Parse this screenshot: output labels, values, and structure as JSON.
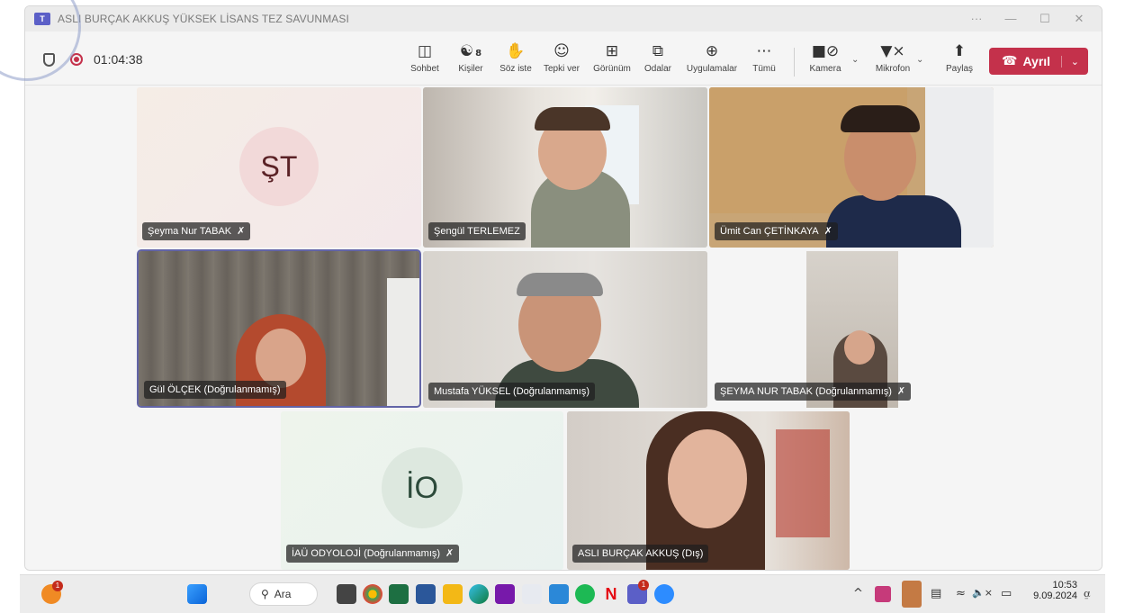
{
  "window": {
    "title": "ASLI BURÇAK AKKUŞ YÜKSEK LİSANS TEZ SAVUNMASI",
    "more": "···",
    "minimize": "—",
    "maximize": "☐",
    "close": "✕"
  },
  "meeting": {
    "timer": "01:04:38"
  },
  "toolbar": {
    "items": [
      {
        "label": "Sohbet",
        "glyph": "💬"
      },
      {
        "label": "Kişiler",
        "glyph": "👥",
        "count": "8"
      },
      {
        "label": "Söz iste",
        "glyph": "✋"
      },
      {
        "label": "Tepki ver",
        "glyph": "☺"
      },
      {
        "label": "Görünüm",
        "glyph": "⊞"
      },
      {
        "label": "Odalar",
        "glyph": "⧉"
      },
      {
        "label": "Uygulamalar",
        "glyph": "⊕"
      },
      {
        "label": "Tümü",
        "glyph": "···"
      },
      {
        "label": "Kamera",
        "glyph": "🎥"
      },
      {
        "label": "Mikrofon",
        "glyph": "🔇"
      },
      {
        "label": "Paylaş",
        "glyph": "⬆"
      }
    ],
    "leave_label": "Ayrıl"
  },
  "participants": [
    {
      "name": "Şeyma Nur TABAK",
      "muted": true,
      "initials": "ŞT"
    },
    {
      "name": "Şengül TERLEMEZ",
      "muted": false
    },
    {
      "name": "Ümit Can ÇETİNKAYA",
      "muted": true
    },
    {
      "name": "Gül ÖLÇEK (Doğrulanmamış)",
      "muted": false
    },
    {
      "name": "Mustafa YÜKSEL (Doğrulanmamış)",
      "muted": false
    },
    {
      "name": "ŞEYMA NUR TABAK (Doğrulanmamış)",
      "muted": true
    },
    {
      "name": "İAÜ ODYOLOJİ (Doğrulanmamış)",
      "muted": true,
      "initials": "İO"
    },
    {
      "name": "ASLI BURÇAK AKKUŞ (Dış)",
      "muted": false
    }
  ],
  "taskbar": {
    "search_label": "Ara",
    "time": "10:53",
    "date": "9.09.2024",
    "badge_1": "1",
    "badge_2": "1",
    "tray_up": "^",
    "tray_mute": "🔈×"
  }
}
